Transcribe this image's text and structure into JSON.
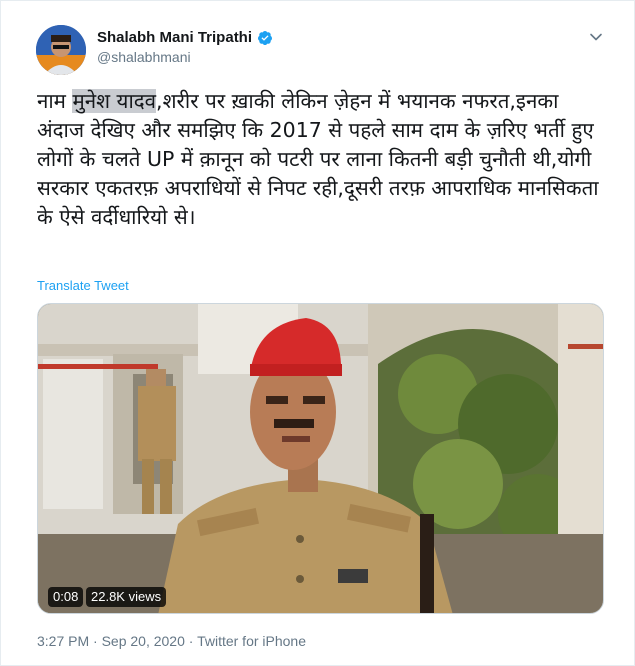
{
  "author": {
    "display_name": "Shalabh Mani Tripathi",
    "handle": "@shalabhmani",
    "verified": true,
    "avatar_icon": "profile-photo"
  },
  "tweet": {
    "text_before": "नाम ",
    "text_highlight": "मुनेश यादव",
    "text_after": ",शरीर पर ख़ाकी लेकिन ज़ेहन में भयानक नफरत,इनका अंदाज देखिए और समझिए कि 2017 से पहले साम दाम के ज़रिए भर्ती हुए लोगों के चलते UP में क़ानून को पटरी पर लाना कितनी बड़ी चुनौती थी,योगी सरकार एकतरफ़ अपराधियों से निपट रही,दूसरी तरफ़ आपराधिक मानसिकता के ऐसे वर्दीधारियो से।",
    "translate_label": "Translate Tweet"
  },
  "media": {
    "duration": "0:08",
    "views": "22.8K views"
  },
  "meta": {
    "timestamp": "3:27 PM · Sep 20, 2020 · Twitter for iPhone"
  },
  "colors": {
    "accent": "#1da1f2",
    "secondary_text": "#657786",
    "highlight": "#c9ccd1"
  }
}
